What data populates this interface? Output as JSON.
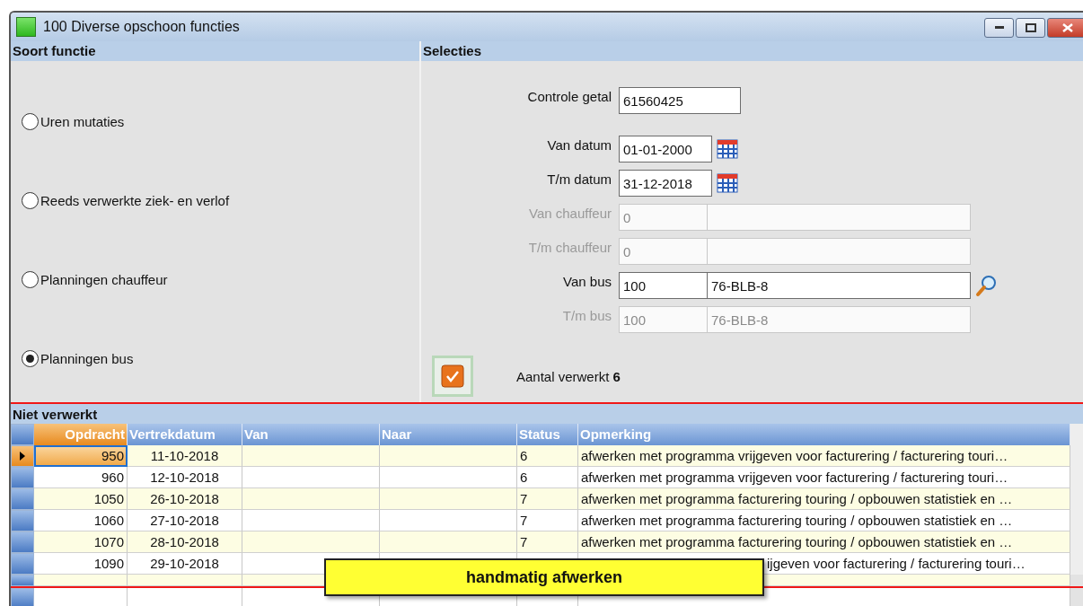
{
  "window": {
    "title": "100 Diverse opschoon functies"
  },
  "function_type": {
    "title": "Soort functie",
    "options": [
      {
        "label": "Uren mutaties",
        "selected": false
      },
      {
        "label": "Reeds verwerkte ziek- en verlof",
        "selected": false
      },
      {
        "label": "Planningen chauffeur",
        "selected": false
      },
      {
        "label": "Planningen bus",
        "selected": true
      }
    ]
  },
  "selections": {
    "title": "Selecties",
    "fields": [
      {
        "kind": "single",
        "label": "Controle getal",
        "value": "61560425",
        "disabled": false
      },
      {
        "kind": "date",
        "label": "Van datum",
        "value": "01-01-2000",
        "disabled": false
      },
      {
        "kind": "date",
        "label": "T/m datum",
        "value": "31-12-2018",
        "disabled": false
      },
      {
        "kind": "pair",
        "label": "Van chauffeur",
        "value": "0",
        "disabled": true
      },
      {
        "kind": "pair",
        "label": "T/m chauffeur",
        "value": "0",
        "disabled": true
      },
      {
        "kind": "lookup",
        "label": "Van bus",
        "value": "100",
        "description": "76-BLB-8",
        "disabled": false
      },
      {
        "kind": "pair",
        "label": "T/m bus",
        "value": "100",
        "description": "76-BLB-8",
        "disabled": true
      }
    ]
  },
  "processed": {
    "label": "Aantal verwerkt",
    "count": "6"
  },
  "grid": {
    "title": "Niet verwerkt",
    "columns": [
      "Opdracht",
      "Vertrekdatum",
      "Van",
      "Naar",
      "Status",
      "Opmerking"
    ],
    "rows": [
      {
        "selected": true,
        "opdracht": "950",
        "vertrekdatum": "11-10-2018",
        "status": "6",
        "opmerking": "afwerken met programma vrijgeven voor facturering / facturering touri…",
        "partly_covered": false
      },
      {
        "selected": false,
        "opdracht": "960",
        "vertrekdatum": "12-10-2018",
        "status": "6",
        "opmerking": "afwerken met programma vrijgeven voor facturering / facturering touri…",
        "partly_covered": false
      },
      {
        "selected": false,
        "opdracht": "1050",
        "vertrekdatum": "26-10-2018",
        "status": "7",
        "opmerking": "afwerken met programma facturering touring / opbouwen statistiek en …",
        "partly_covered": false
      },
      {
        "selected": false,
        "opdracht": "1060",
        "vertrekdatum": "27-10-2018",
        "status": "7",
        "opmerking": "afwerken met programma facturering touring / opbouwen statistiek en …",
        "partly_covered": false
      },
      {
        "selected": false,
        "opdracht": "1070",
        "vertrekdatum": "28-10-2018",
        "status": "7",
        "opmerking": "afwerken met programma facturering touring / opbouwen statistiek en …",
        "partly_covered": false
      },
      {
        "selected": false,
        "opdracht": "1090",
        "vertrekdatum": "29-10-2018",
        "opmerking": "ijgeven voor facturering / facturering touri…",
        "partly_covered": true
      }
    ]
  },
  "callout": {
    "text": "handmatig afwerken"
  }
}
